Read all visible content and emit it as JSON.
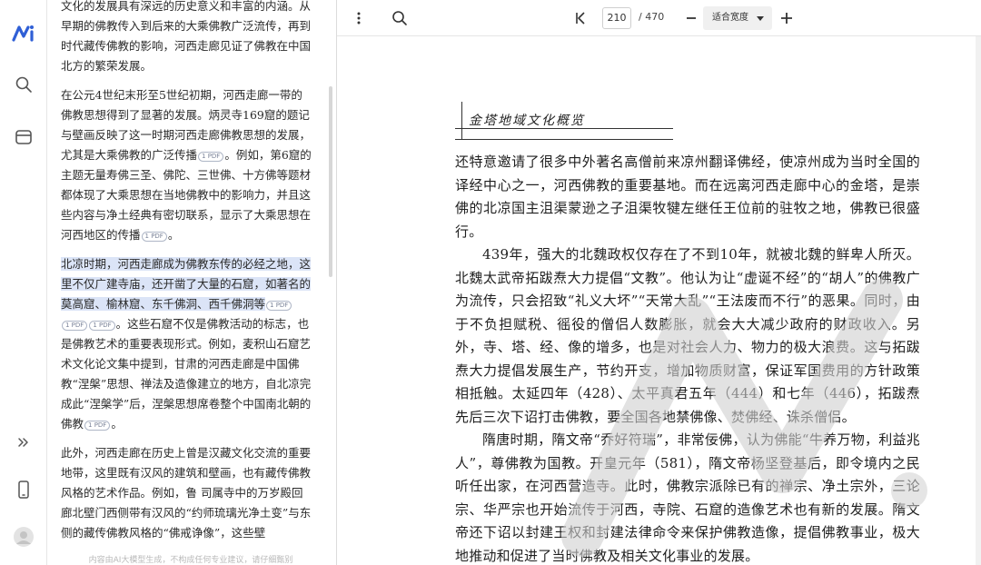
{
  "rail": {
    "items": [
      {
        "name": "logo-icon",
        "label": "app-logo"
      },
      {
        "name": "search-icon",
        "label": "search"
      },
      {
        "name": "sidebar-icon",
        "label": "panel"
      },
      {
        "name": "collapse-icon",
        "label": "collapse"
      },
      {
        "name": "phone-icon",
        "label": "mobile"
      },
      {
        "name": "avatar",
        "label": "user"
      }
    ],
    "accent": "#2f5fd6"
  },
  "chat": {
    "p0": "文化的发展具有深远的历史意义和丰富的内涵。从早期的佛教传入到后来的大乘佛教广泛流传，再到时代藏传佛教的影响，河西走廊见证了佛教在中国北方的繁荣发展。",
    "p1a": "在公元4世纪末形至5世纪初期，河西走廊一带的佛教思想得到了显著的发展。炳灵寺169窟的题记与壁画反映了这一时期河西走廊佛教思想的发展，尤其是大乘佛教的广泛传播",
    "p1b": "。例如，第6窟的主题无量寿佛三圣、佛陀、三世佛、十方佛等题材都体现了大乘思想在当地佛教中的影响力，并且这些内容与净土经典有密切联系，显示了大乘思想在河西地区的传播",
    "p1c": "。",
    "p2hl": "北凉时期，河西走廊成为佛教东传的必经之地，这里不仅广建寺庙，还开凿了大量的石窟，如著名的莫高窟、榆林窟、东千佛洞、西千佛洞等",
    "p2b": "。这些石窟不仅是佛教活动的标志，也是佛教艺术的重要表现形式。例如，麦积山石窟艺术文化论文集中提到，甘肃的河西走廊是中国佛教“涅槃”思想、禅法及造像建立的地方，自北凉完成此“涅槃学”后，涅槃思想席卷整个中国南北朝的佛教",
    "p2c": "。",
    "p3": "此外，河西走廊在历史上曾是汉藏文化交流的重要地带，这里既有汉风的建筑和壁画，也有藏传佛教风格的艺术作品。例如，鲁 司属寺中的万岁殿回廊北壁门西侧带有汉风的“约师琉璃光净土变”与东侧的藏传佛教风格的“佛戒诤像”，这些壁",
    "cite_label": "1 PDF",
    "disclaimer": "内容由AI大模型生成，不构成任何专业建议，请仔细甄别"
  },
  "toolbar": {
    "current_page": "210",
    "total_pages": "/ 470",
    "zoom": "适合宽度"
  },
  "book": {
    "header": "金塔地域文化概览",
    "paragraphs": [
      "还特意邀请了很多中外著名高僧前来凉州翻译佛经，使凉州成为当时全国的译经中心之一，河西佛教的重要基地。而在远离河西走廊中心的金塔，是崇佛的北凉国主沮渠蒙逊之子沮渠牧犍左继任王位前的驻牧之地，佛教已很盛行。",
      "439年，强大的北魏政权仅存在了不到10年，就被北魏的鲜卑人所灭。北魏太武帝拓跋焘大力提倡“文教”。他认为让“虚诞不经”的“胡人”的佛教广为流传，只会招致“礼义大坏”“天常大乱”“王法废而不行”的恶果。同时，由于不负担赋税、徭役的僧侣人数膨胀，就会大大减少政府的财政收入。另外，寺、塔、经、像的增多，也是对社会人力、物力的极大浪费。这与拓跋焘大力提倡发展生产，节约开支，增加物质财富，保证军国费用的方针政策相抵触。太延四年（428）、太平真君五年（444）和七年（446），拓跋焘先后三次下诏打击佛教，要全国各地禁佛像、焚佛经、诛杀僧侣。",
      "隋唐时期，隋文帝“乔好符瑞”，非常佞佛，认为佛能“牛养万物，利益兆人”，尊佛教为国教。开皇元年（581），隋文帝杨坚登基后，即令境内之民听任出家，在河西营造寺。此时，佛教宗派除已有的禅宗、净土宗外，三论宗、华严宗也开始流传于河西，寺院、石窟的造像艺术也有新的发展。隋文帝还下诏以封建王权和封建法律命令来保护佛教造像，提倡佛教事业，极大地推动和促进了当时佛教及相关文化事业的发展。"
    ]
  }
}
